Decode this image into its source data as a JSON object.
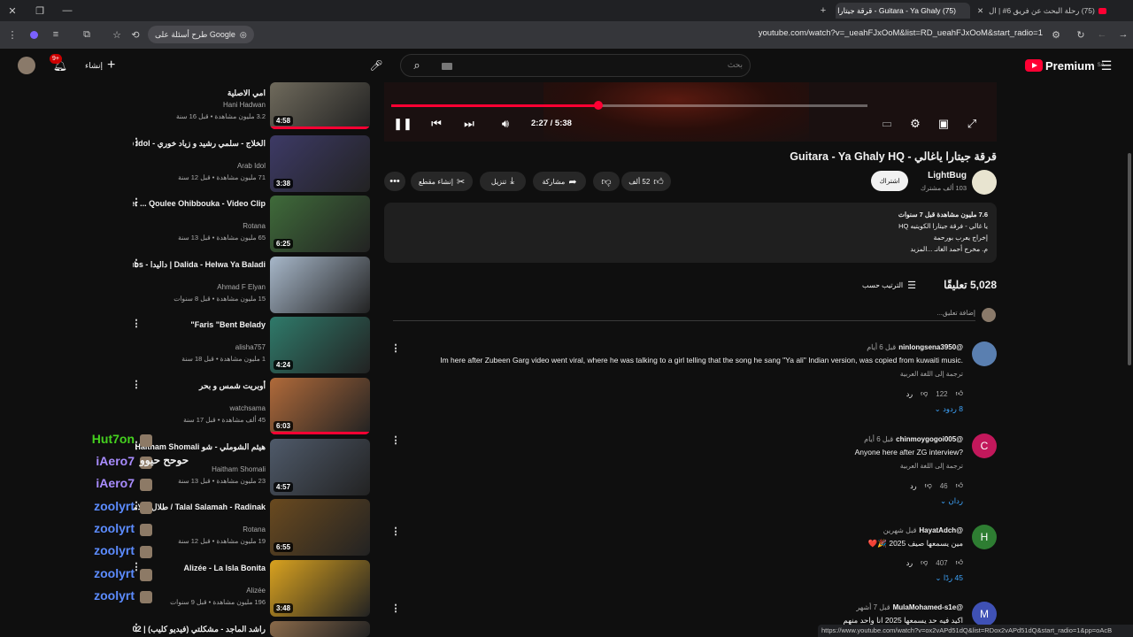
{
  "browser": {
    "tabs": [
      {
        "title": "(75) Guitara - Ya Ghaly - قرقة جيتارا يا غالي",
        "active": true
      },
      {
        "title": "(75) رحلة البحث عن فريق 6# | ال",
        "active": false
      }
    ],
    "url": "youtube.com/watch?v=_ueahFJxOoM&list=RD_ueahFJxOoM&start_radio=1",
    "google_chip": "طرح أسئلة على Google",
    "status_url": "https://www.youtube.com/watch?v=ox2vAPd51dQ&list=RDox2vAPd51dQ&start_radio=1&pp=oAcB"
  },
  "header": {
    "logo_text": "Premium",
    "logo_region": "SA",
    "search_placeholder": "بحث",
    "create_label": "إنشاء",
    "notification_count": "9+"
  },
  "playlist": [
    {
      "title": "امي الاصلية",
      "channel": "Hani Hadwan",
      "meta": "3.2 مليون مشاهدة • قبل 16 سنة",
      "duration": "4:58",
      "thumb_color": "#6f6a5c",
      "progress": 1.0
    },
    {
      "title": "الخلاج - سلمي رشيد و زياد خوري - Arab Idol",
      "channel": "Arab Idol",
      "meta": "71 مليون مشاهدة • قبل 12 سنة",
      "duration": "3:38",
      "thumb_color": "#3d3a66",
      "progress": 0
    },
    {
      "title": "Kadim Al Saher ... Qoulee Ohibbouka - Video Clip | كاظم ...",
      "channel": "Rotana",
      "meta": "65 مليون مشاهدة • قبل 13 سنة",
      "duration": "6:25",
      "thumb_color": "#3f6b3a",
      "progress": 0
    },
    {
      "title": "Dalida - Helwa Ya Baladi | داليدا - English Subs | حلوه يا بلدي",
      "channel": "Ahmad F Elyan",
      "meta": "15 مليون مشاهدة • قبل 8 سنوات",
      "duration": "",
      "thumb_color": "#a7b7c9",
      "progress": 0
    },
    {
      "title": "Faris \"Bent Belady\"",
      "channel": "alisha757",
      "meta": "1 مليون مشاهدة • قبل 18 سنة",
      "duration": "4:24",
      "thumb_color": "#2f7a6a",
      "progress": 0
    },
    {
      "title": "أوبريت شمس و بحر",
      "channel": "watchsama",
      "meta": "45 ألف مشاهدة • قبل 17 سنة",
      "duration": "6:03",
      "thumb_color": "#b06a3a",
      "progress": 1.0
    },
    {
      "title": "هيثم الشوملي - شو Emshi Fewe Haitham Shomali",
      "channel": "Haitham Shomali",
      "meta": "23 مليون مشاهدة • قبل 13 سنة",
      "duration": "4:57",
      "thumb_color": "#4f5a6a",
      "progress": 0
    },
    {
      "title": "Talal Salamah - Radinak / طلال سلامة - رضيناك",
      "channel": "Rotana",
      "meta": "19 مليون مشاهدة • قبل 12 سنة",
      "duration": "6:55",
      "thumb_color": "#6a4a1f",
      "progress": 0
    },
    {
      "title": "Alizée - La Isla Bonita",
      "channel": "Alizée",
      "meta": "196 مليون مشاهدة • قبل 9 سنوات",
      "duration": "3:48",
      "thumb_color": "#d9a21f",
      "progress": 0
    },
    {
      "title": "راشد الماجد - مشكلتي (فيديو كليب) | 2002",
      "channel": "",
      "meta": "",
      "duration": "",
      "thumb_color": "#8a6a4a",
      "progress": 0
    }
  ],
  "chat_overlay": [
    {
      "name": "Hut7on",
      "color": "#45d11f",
      "text": ""
    },
    {
      "name": "iAero7",
      "color": "#a98cff",
      "text": "حوحح حيوو"
    },
    {
      "name": "iAero7",
      "color": "#a98cff",
      "text": ""
    },
    {
      "name": "zoolyrt",
      "color": "#5c8cff",
      "text": ""
    },
    {
      "name": "zoolyrt",
      "color": "#5c8cff",
      "text": ""
    },
    {
      "name": "zoolyrt",
      "color": "#5c8cff",
      "text": ""
    },
    {
      "name": "zoolyrt",
      "color": "#5c8cff",
      "text": ""
    },
    {
      "name": "zoolyrt",
      "color": "#5c8cff",
      "text": ""
    }
  ],
  "player": {
    "current_time": "2:27",
    "duration": "5:38",
    "time_display": "2:27 / 5:38",
    "progress": 0.435,
    "buffered": 1.0
  },
  "video": {
    "title": "قرقة جيتارا ياغالي - Guitara - Ya Ghaly HQ",
    "channel_name": "LightBug",
    "channel_subs": "103 ألف مشترك",
    "join_label": "اشتراك",
    "like_count": "52 ألف",
    "share_label": "مشاركة",
    "download_label": "تنزيل",
    "clip_label": "إنشاء مقطع",
    "description": [
      "7.6 مليون مشاهدة  قبل 7 سنوات",
      "يا غالي - فرقة جيتارا الكويتيه HQ",
      "إخراج يعرب بورحمة",
      "م. مخرج أحمد الغانـ  ...المزيد"
    ]
  },
  "comments_section": {
    "count_label": "5,028 تعليقًا",
    "sort_label": "الترتيب حسب",
    "add_placeholder": "إضافة تعليق...",
    "comments": [
      {
        "author": "@ninlongsena3950",
        "time": "قبل 6 أيام",
        "text": "Im here after Zubeen Garg video went viral, where he was talking to a girl telling that the song he sang \"Ya ali\" Indian version, was copied from kuwaiti music.",
        "translate": "ترجمة إلى اللغة العربية",
        "likes": "122",
        "reply_label": "رد",
        "replies": "8 ردود",
        "avatar_letter": "",
        "avatar_color": "#5a7fb0"
      },
      {
        "author": "@chinmoygogoi005",
        "time": "قبل 6 أيام",
        "text": "Anyone here after ZG interview?",
        "translate": "ترجمة إلى اللغة العربية",
        "likes": "46",
        "reply_label": "رد",
        "replies": "ردان",
        "avatar_letter": "C",
        "avatar_color": "#c2185b"
      },
      {
        "author": "@HayatAdch",
        "time": "قبل شهرين",
        "text": "مين يسمعها صيف 2025 🎉❤️",
        "translate": "",
        "likes": "407",
        "reply_label": "رد",
        "replies": "45 ردًا",
        "avatar_letter": "H",
        "avatar_color": "#2e7d32"
      },
      {
        "author": "@MulaMohamed-s1e",
        "time": "قبل 7 أشهر",
        "text": "اكيد فيه حد يسمعها 2025 انا واحد منهم",
        "translate": "",
        "likes": "",
        "reply_label": "",
        "replies": "",
        "avatar_letter": "M",
        "avatar_color": "#3f51b5"
      }
    ]
  }
}
